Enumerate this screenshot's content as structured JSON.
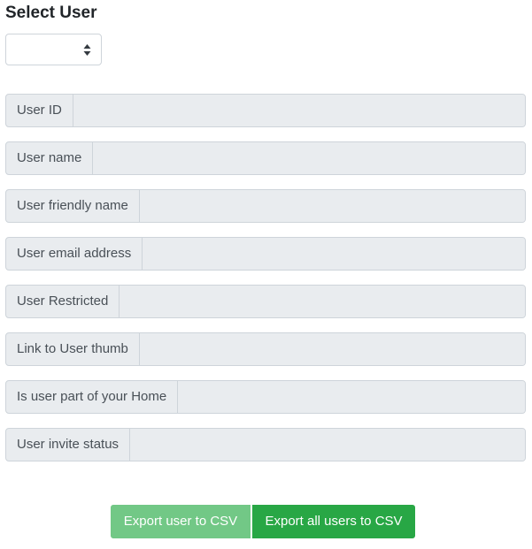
{
  "header": {
    "title": "Select User"
  },
  "user_select": {
    "selected_value": "",
    "icon": "sort-arrows-icon"
  },
  "fields": [
    {
      "label": "User ID",
      "value": ""
    },
    {
      "label": "User name",
      "value": ""
    },
    {
      "label": "User friendly name",
      "value": ""
    },
    {
      "label": "User email address",
      "value": ""
    },
    {
      "label": "User Restricted",
      "value": ""
    },
    {
      "label": "Link to User thumb",
      "value": ""
    },
    {
      "label": "Is user part of your Home",
      "value": ""
    },
    {
      "label": "User invite status",
      "value": ""
    }
  ],
  "actions": {
    "export_user_label": "Export user to CSV",
    "export_all_label": "Export all users to CSV"
  },
  "colors": {
    "success": "#28a745",
    "success_disabled": "#72c886",
    "readonly_bg": "#e9ecef",
    "border": "#ced4da"
  }
}
